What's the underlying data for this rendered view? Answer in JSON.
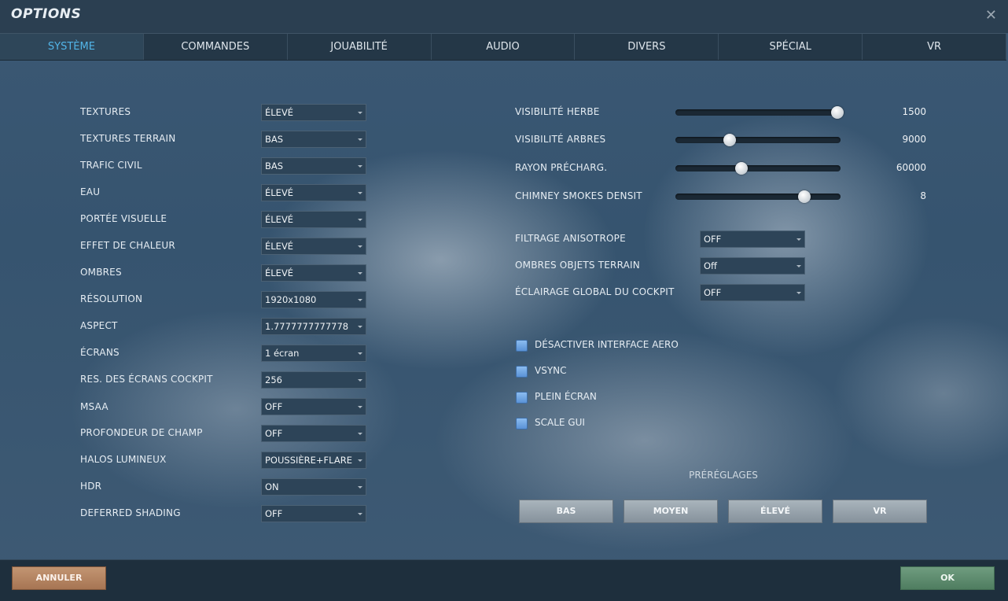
{
  "window": {
    "title": "OPTIONS",
    "close_glyph": "✕"
  },
  "tabs": [
    {
      "label": "SYSTÈME",
      "active": true
    },
    {
      "label": "COMMANDES"
    },
    {
      "label": "JOUABILITÉ"
    },
    {
      "label": "AUDIO"
    },
    {
      "label": "DIVERS"
    },
    {
      "label": "SPÉCIAL"
    },
    {
      "label": "VR"
    }
  ],
  "left_settings": [
    {
      "label": "TEXTURES",
      "value": "ÉLEVÉ"
    },
    {
      "label": "TEXTURES TERRAIN",
      "value": "BAS"
    },
    {
      "label": "TRAFIC CIVIL",
      "value": "BAS"
    },
    {
      "label": "EAU",
      "value": "ÉLEVÉ"
    },
    {
      "label": "PORTÉE VISUELLE",
      "value": "ÉLEVÉ"
    },
    {
      "label": "EFFET DE CHALEUR",
      "value": "ÉLEVÉ"
    },
    {
      "label": "OMBRES",
      "value": "ÉLEVÉ"
    },
    {
      "label": "RÉSOLUTION",
      "value": "1920x1080"
    },
    {
      "label": "ASPECT",
      "value": "1.7777777777778"
    },
    {
      "label": "ÉCRANS",
      "value": "1 écran"
    },
    {
      "label": "RES. DES ÉCRANS COCKPIT",
      "value": "256"
    },
    {
      "label": "MSAA",
      "value": "OFF"
    },
    {
      "label": "PROFONDEUR DE CHAMP",
      "value": "OFF"
    },
    {
      "label": "HALOS LUMINEUX",
      "value": "POUSSIÈRE+FLARE"
    },
    {
      "label": "HDR",
      "value": "ON"
    },
    {
      "label": "DEFERRED SHADING",
      "value": "OFF"
    }
  ],
  "sliders": [
    {
      "label": "VISIBILITÉ HERBE",
      "value": "1500",
      "level": 0.98
    },
    {
      "label": "VISIBILITÉ ARBRES",
      "value": "9000",
      "level": 0.33
    },
    {
      "label": "RAYON PRÉCHARG.",
      "value": "60000",
      "level": 0.4
    },
    {
      "label": "CHIMNEY SMOKES DENSIT",
      "value": "8",
      "level": 0.78
    }
  ],
  "right_settings": [
    {
      "label": "FILTRAGE ANISOTROPE",
      "value": "OFF"
    },
    {
      "label": "OMBRES OBJETS TERRAIN",
      "value": "Off"
    },
    {
      "label": "ÉCLAIRAGE GLOBAL DU COCKPIT",
      "value": "OFF"
    }
  ],
  "checkboxes": [
    {
      "label": "DÉSACTIVER INTERFACE AERO"
    },
    {
      "label": "VSYNC"
    },
    {
      "label": "PLEIN ÉCRAN"
    },
    {
      "label": "SCALE GUI"
    }
  ],
  "presets": {
    "label": "PRÉRÉGLAGES",
    "buttons": [
      "BAS",
      "MOYEN",
      "ÉLEVÉ",
      "VR"
    ]
  },
  "footer": {
    "cancel_label": "ANNULER",
    "ok_label": "OK"
  }
}
